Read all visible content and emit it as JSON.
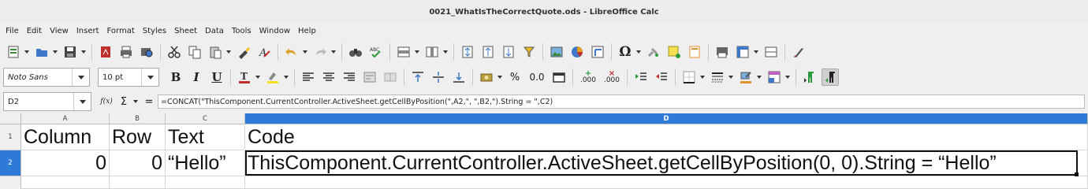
{
  "window": {
    "title": "0021_WhatIsTheCorrectQuote.ods - LibreOffice Calc"
  },
  "menu": [
    "File",
    "Edit",
    "View",
    "Insert",
    "Format",
    "Styles",
    "Sheet",
    "Data",
    "Tools",
    "Window",
    "Help"
  ],
  "format_bar": {
    "font_name": "Noto Sans",
    "font_size": "10 pt",
    "bold_glyph": "B",
    "italic_glyph": "I",
    "underline_glyph": "U",
    "percent_glyph": "%",
    "number_glyph": "0.0",
    "add_decimal_glyph": ".000",
    "del_decimal_glyph": ".000"
  },
  "formula_bar": {
    "name_box": "D2",
    "fx_glyph": "f(x)",
    "sigma_glyph": "Σ",
    "equals_glyph": "=",
    "formula": "=CONCAT(\"ThisComponent.CurrentController.ActiveSheet.getCellByPosition(\",A2,\", \",B2,\").String = \",C2)"
  },
  "sheet": {
    "columns": [
      "A",
      "B",
      "C",
      "D"
    ],
    "rows": [
      "1",
      "2"
    ],
    "selected_cell": "D2",
    "cells": {
      "A1": "Column",
      "B1": "Row",
      "C1": "Text",
      "D1": "Code",
      "A2": "0",
      "B2": "0",
      "C2": "“Hello”",
      "D2": "ThisComponent.CurrentController.ActiveSheet.getCellByPosition(0, 0).String = “Hello”"
    }
  },
  "colors": {
    "selection": "#2d7bd6",
    "background": "#efefef"
  }
}
